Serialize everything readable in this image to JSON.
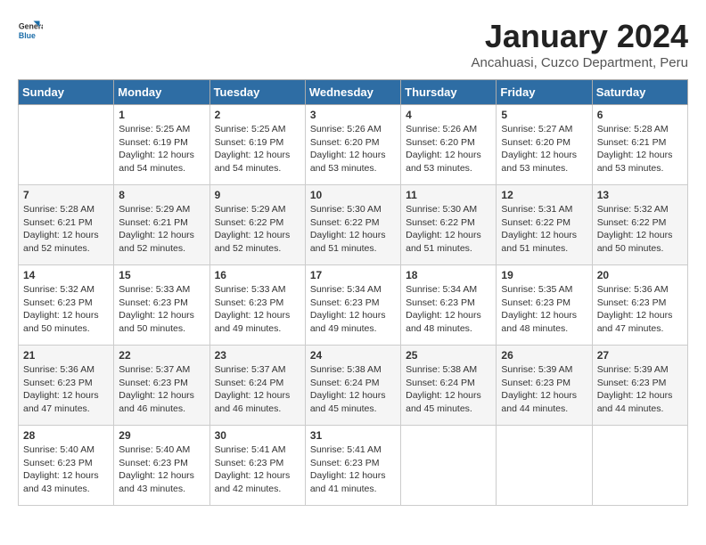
{
  "logo": {
    "text_general": "General",
    "text_blue": "Blue"
  },
  "header": {
    "month": "January 2024",
    "location": "Ancahuasi, Cuzco Department, Peru"
  },
  "days_of_week": [
    "Sunday",
    "Monday",
    "Tuesday",
    "Wednesday",
    "Thursday",
    "Friday",
    "Saturday"
  ],
  "weeks": [
    [
      {
        "day": "",
        "content": ""
      },
      {
        "day": "1",
        "content": "Sunrise: 5:25 AM\nSunset: 6:19 PM\nDaylight: 12 hours\nand 54 minutes."
      },
      {
        "day": "2",
        "content": "Sunrise: 5:25 AM\nSunset: 6:19 PM\nDaylight: 12 hours\nand 54 minutes."
      },
      {
        "day": "3",
        "content": "Sunrise: 5:26 AM\nSunset: 6:20 PM\nDaylight: 12 hours\nand 53 minutes."
      },
      {
        "day": "4",
        "content": "Sunrise: 5:26 AM\nSunset: 6:20 PM\nDaylight: 12 hours\nand 53 minutes."
      },
      {
        "day": "5",
        "content": "Sunrise: 5:27 AM\nSunset: 6:20 PM\nDaylight: 12 hours\nand 53 minutes."
      },
      {
        "day": "6",
        "content": "Sunrise: 5:28 AM\nSunset: 6:21 PM\nDaylight: 12 hours\nand 53 minutes."
      }
    ],
    [
      {
        "day": "7",
        "content": "Sunrise: 5:28 AM\nSunset: 6:21 PM\nDaylight: 12 hours\nand 52 minutes."
      },
      {
        "day": "8",
        "content": "Sunrise: 5:29 AM\nSunset: 6:21 PM\nDaylight: 12 hours\nand 52 minutes."
      },
      {
        "day": "9",
        "content": "Sunrise: 5:29 AM\nSunset: 6:22 PM\nDaylight: 12 hours\nand 52 minutes."
      },
      {
        "day": "10",
        "content": "Sunrise: 5:30 AM\nSunset: 6:22 PM\nDaylight: 12 hours\nand 51 minutes."
      },
      {
        "day": "11",
        "content": "Sunrise: 5:30 AM\nSunset: 6:22 PM\nDaylight: 12 hours\nand 51 minutes."
      },
      {
        "day": "12",
        "content": "Sunrise: 5:31 AM\nSunset: 6:22 PM\nDaylight: 12 hours\nand 51 minutes."
      },
      {
        "day": "13",
        "content": "Sunrise: 5:32 AM\nSunset: 6:22 PM\nDaylight: 12 hours\nand 50 minutes."
      }
    ],
    [
      {
        "day": "14",
        "content": "Sunrise: 5:32 AM\nSunset: 6:23 PM\nDaylight: 12 hours\nand 50 minutes."
      },
      {
        "day": "15",
        "content": "Sunrise: 5:33 AM\nSunset: 6:23 PM\nDaylight: 12 hours\nand 50 minutes."
      },
      {
        "day": "16",
        "content": "Sunrise: 5:33 AM\nSunset: 6:23 PM\nDaylight: 12 hours\nand 49 minutes."
      },
      {
        "day": "17",
        "content": "Sunrise: 5:34 AM\nSunset: 6:23 PM\nDaylight: 12 hours\nand 49 minutes."
      },
      {
        "day": "18",
        "content": "Sunrise: 5:34 AM\nSunset: 6:23 PM\nDaylight: 12 hours\nand 48 minutes."
      },
      {
        "day": "19",
        "content": "Sunrise: 5:35 AM\nSunset: 6:23 PM\nDaylight: 12 hours\nand 48 minutes."
      },
      {
        "day": "20",
        "content": "Sunrise: 5:36 AM\nSunset: 6:23 PM\nDaylight: 12 hours\nand 47 minutes."
      }
    ],
    [
      {
        "day": "21",
        "content": "Sunrise: 5:36 AM\nSunset: 6:23 PM\nDaylight: 12 hours\nand 47 minutes."
      },
      {
        "day": "22",
        "content": "Sunrise: 5:37 AM\nSunset: 6:23 PM\nDaylight: 12 hours\nand 46 minutes."
      },
      {
        "day": "23",
        "content": "Sunrise: 5:37 AM\nSunset: 6:24 PM\nDaylight: 12 hours\nand 46 minutes."
      },
      {
        "day": "24",
        "content": "Sunrise: 5:38 AM\nSunset: 6:24 PM\nDaylight: 12 hours\nand 45 minutes."
      },
      {
        "day": "25",
        "content": "Sunrise: 5:38 AM\nSunset: 6:24 PM\nDaylight: 12 hours\nand 45 minutes."
      },
      {
        "day": "26",
        "content": "Sunrise: 5:39 AM\nSunset: 6:23 PM\nDaylight: 12 hours\nand 44 minutes."
      },
      {
        "day": "27",
        "content": "Sunrise: 5:39 AM\nSunset: 6:23 PM\nDaylight: 12 hours\nand 44 minutes."
      }
    ],
    [
      {
        "day": "28",
        "content": "Sunrise: 5:40 AM\nSunset: 6:23 PM\nDaylight: 12 hours\nand 43 minutes."
      },
      {
        "day": "29",
        "content": "Sunrise: 5:40 AM\nSunset: 6:23 PM\nDaylight: 12 hours\nand 43 minutes."
      },
      {
        "day": "30",
        "content": "Sunrise: 5:41 AM\nSunset: 6:23 PM\nDaylight: 12 hours\nand 42 minutes."
      },
      {
        "day": "31",
        "content": "Sunrise: 5:41 AM\nSunset: 6:23 PM\nDaylight: 12 hours\nand 41 minutes."
      },
      {
        "day": "",
        "content": ""
      },
      {
        "day": "",
        "content": ""
      },
      {
        "day": "",
        "content": ""
      }
    ]
  ]
}
